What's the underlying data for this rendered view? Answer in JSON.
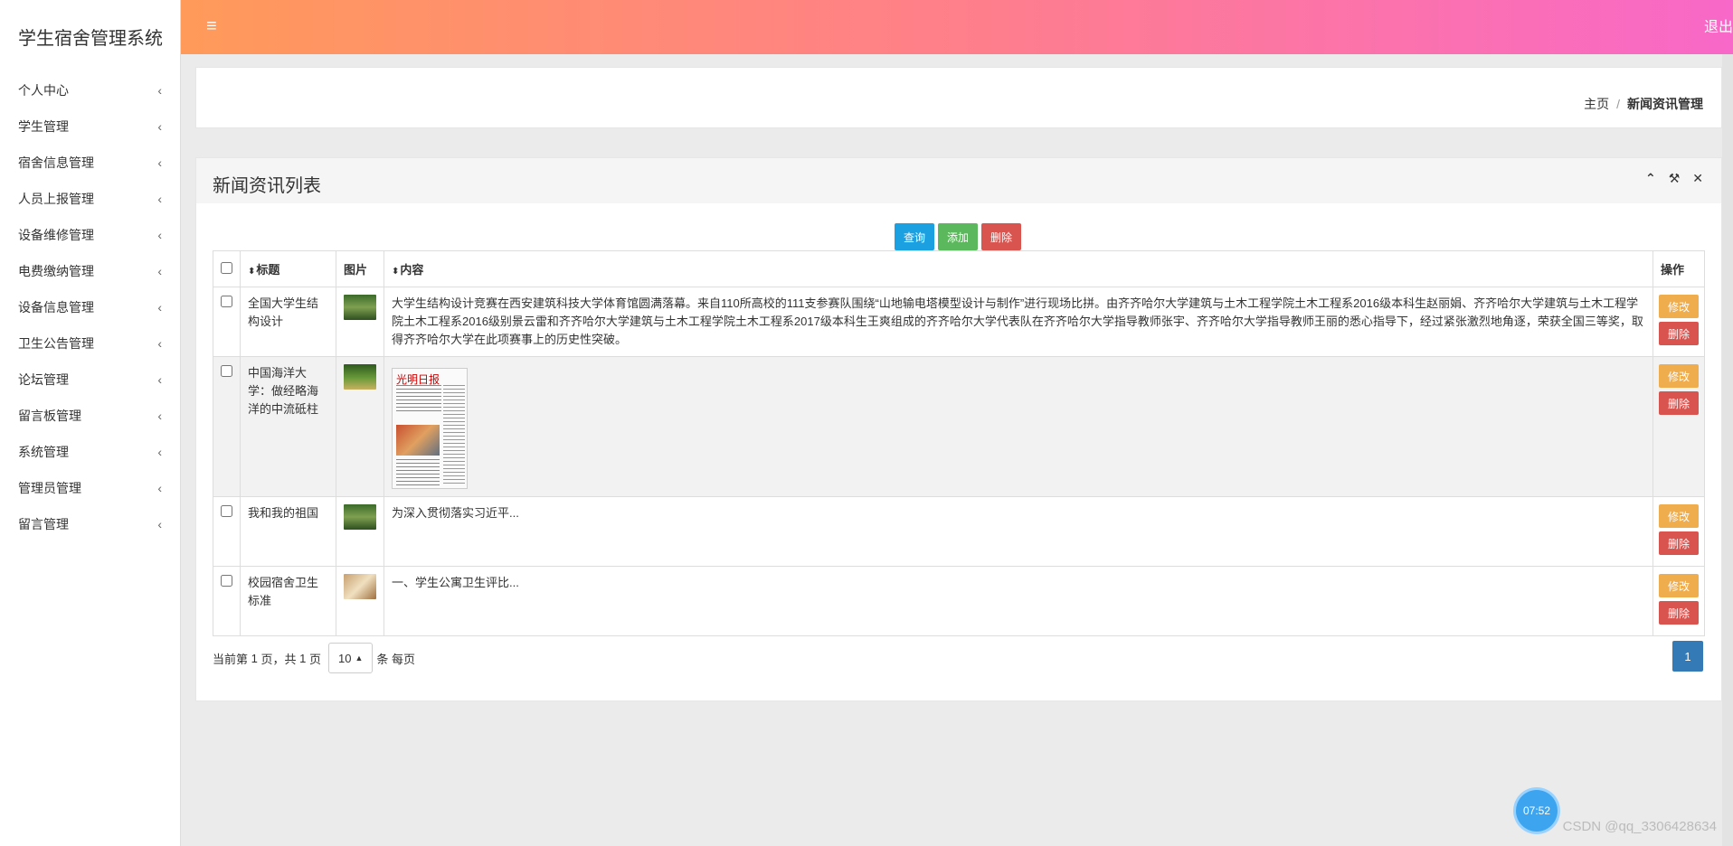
{
  "brand": "学生宿舍管理系统",
  "menu": [
    "个人中心",
    "学生管理",
    "宿舍信息管理",
    "人员上报管理",
    "设备维修管理",
    "电费缴纳管理",
    "设备信息管理",
    "卫生公告管理",
    "论坛管理",
    "留言板管理",
    "系统管理",
    "管理员管理",
    "留言管理"
  ],
  "topbar": {
    "menu_icon": "≡",
    "logout": "退出"
  },
  "breadcrumb": {
    "home": "主页",
    "sep": "/",
    "current": "新闻资讯管理"
  },
  "card": {
    "title": "新闻资讯列表",
    "tools": {
      "collapse": "⌃",
      "wrench": "🔧",
      "close": "✕"
    }
  },
  "toolbar": {
    "query": "查询",
    "add": "添加",
    "delete": "删除"
  },
  "table": {
    "headers": {
      "title": "标题",
      "image": "图片",
      "content": "内容",
      "ops": "操作"
    },
    "rows": [
      {
        "title": "全国大学生结构设计",
        "content": "大学生结构设计竞赛在西安建筑科技大学体育馆圆满落幕。来自110所高校的111支参赛队围绕“山地输电塔模型设计与制作”进行现场比拼。由齐齐哈尔大学建筑与土木工程学院土木工程系2016级本科生赵丽娟、齐齐哈尔大学建筑与土木工程学院土木工程系2016级别景云雷和齐齐哈尔大学建筑与土木工程学院土木工程系2017级本科生王爽组成的齐齐哈尔大学代表队在齐齐哈尔大学指导教师张宇、齐齐哈尔大学指导教师王丽的悉心指导下，经过紧张激烈地角逐，荣获全国三等奖，取得齐齐哈尔大学在此项赛事上的历史性突破。",
        "thumb": "forest",
        "edit": "修改",
        "del": "删除"
      },
      {
        "title": "中国海洋大学：做经略海洋的中流砥柱",
        "content": "",
        "newspaper_masthead": "光明日报",
        "thumb": "field",
        "edit": "修改",
        "del": "删除"
      },
      {
        "title": "我和我的祖国",
        "content": "为深入贯彻落实习近平...",
        "thumb": "forest",
        "edit": "修改",
        "del": "删除"
      },
      {
        "title": "校园宿舍卫生标准",
        "content": "一、学生公寓卫生评比...",
        "thumb": "room",
        "edit": "修改",
        "del": "删除"
      }
    ]
  },
  "pagination": {
    "prefix": "当前第",
    "current_page": "1",
    "mid": "页，共",
    "total_pages": "1",
    "suffix": "页",
    "page_size": "10",
    "per_page": "条 每页",
    "active_page": "1"
  },
  "clock": "07:52",
  "watermark": "CSDN @qq_3306428634",
  "colors": {
    "accent_start": "#ff9a5a",
    "accent_end": "#f868c8",
    "query": "#1ba1e2",
    "add": "#5cb85c",
    "delete": "#d9534f",
    "edit": "#f0ad4e",
    "page": "#337ab7"
  }
}
